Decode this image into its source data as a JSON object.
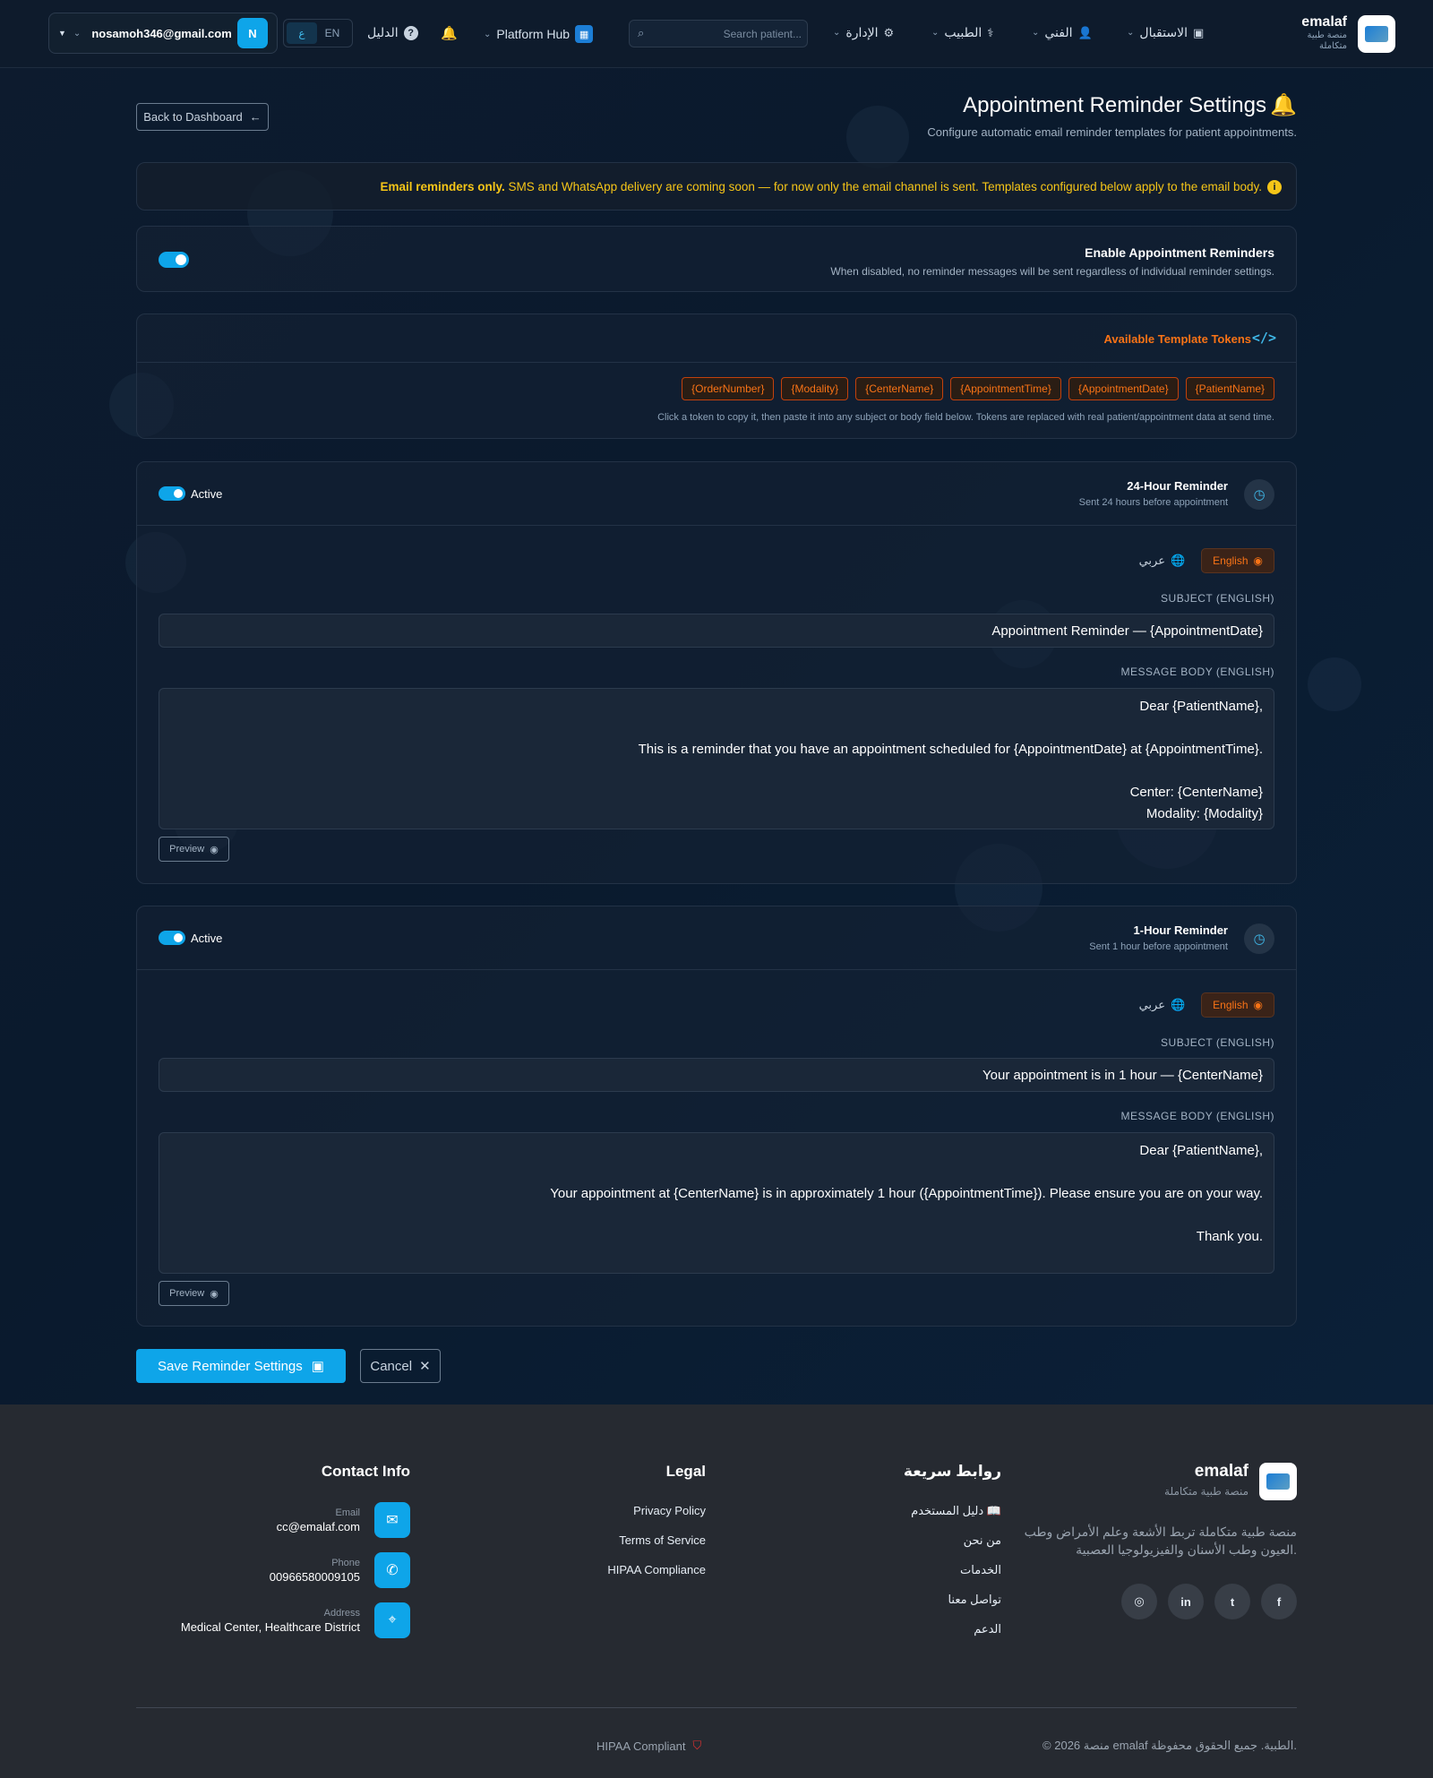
{
  "navbar": {
    "brand_name": "emalaf",
    "brand_sub": "منصة طبية متكاملة",
    "reception": "الاستقبال",
    "technician": "الفني",
    "doctor": "الطبيب",
    "admin": "الإدارة",
    "search_placeholder": "Search patient...",
    "platform_hub": "Platform Hub",
    "guide": "الدليل",
    "lang_ar": "ع",
    "lang_en": "EN",
    "user_email": "nosamoh346@gmail.com",
    "user_initial": "N"
  },
  "page": {
    "back_label": "Back to Dashboard",
    "title": "Appointment Reminder Settings",
    "subtitle": "Configure automatic email reminder templates for patient appointments."
  },
  "alert": {
    "bold": "Email reminders only.",
    "text": " SMS and WhatsApp delivery are coming soon — for now only the email channel is sent. Templates configured below apply to the email body."
  },
  "enable": {
    "title": "Enable Appointment Reminders",
    "desc": "When disabled, no reminder messages will be sent regardless of individual reminder settings."
  },
  "tokens": {
    "title": "Available Template Tokens",
    "items": [
      "{PatientName}",
      "{AppointmentDate}",
      "{AppointmentTime}",
      "{CenterName}",
      "{Modality}",
      "{OrderNumber}"
    ],
    "note": "Click a token to copy it, then paste it into any subject or body field below. Tokens are replaced with real patient/appointment data at send time."
  },
  "reminders": [
    {
      "title": "24-Hour Reminder",
      "subtitle": "Sent 24 hours before appointment",
      "active_label": "Active",
      "tab_en": "English",
      "tab_ar": "عربي",
      "subject_label": "SUBJECT (ENGLISH)",
      "subject": "Appointment Reminder — {AppointmentDate}",
      "body_label": "MESSAGE BODY (ENGLISH)",
      "body": "Dear {PatientName},\n\nThis is a reminder that you have an appointment scheduled for {AppointmentDate} at {AppointmentTime}.\n\nCenter: {CenterName}\nModality: {Modality}",
      "preview_label": "Preview"
    },
    {
      "title": "1-Hour Reminder",
      "subtitle": "Sent 1 hour before appointment",
      "active_label": "Active",
      "tab_en": "English",
      "tab_ar": "عربي",
      "subject_label": "SUBJECT (ENGLISH)",
      "subject": "Your appointment is in 1 hour — {CenterName}",
      "body_label": "MESSAGE BODY (ENGLISH)",
      "body": "Dear {PatientName},\n\nYour appointment at {CenterName} is in approximately 1 hour ({AppointmentTime}). Please ensure you are on your way.\n\nThank you.",
      "preview_label": "Preview"
    }
  ],
  "actions": {
    "save": "Save Reminder Settings",
    "cancel": "Cancel"
  },
  "footer": {
    "brand": "emalaf",
    "brand_sub": "منصة طبية متكاملة",
    "desc": "منصة طبية متكاملة تربط الأشعة وعلم الأمراض وطب العيون وطب الأسنان والفيزيولوجيا العصبية.",
    "quick_title": "روابط سريعة",
    "quick_links": [
      "دليل المستخدم",
      "من نحن",
      "الخدمات",
      "تواصل معنا",
      "الدعم"
    ],
    "legal_title": "Legal",
    "legal_links": [
      "Privacy Policy",
      "Terms of Service",
      "HIPAA Compliance"
    ],
    "contact_title": "Contact Info",
    "email_label": "Email",
    "email": "cc@emalaf.com",
    "phone_label": "Phone",
    "phone": "00966580009105",
    "address_label": "Address",
    "address": "Medical Center, Healthcare District",
    "copyright": "© 2026 منصة emalaf الطبية. جميع الحقوق محفوظة.",
    "hipaa": "HIPAA Compliant"
  },
  "colors": {
    "accent": "#0ea5e9",
    "orange": "#f97316",
    "warning": "#f5c518",
    "background": "#0a1628",
    "footer": "#262a31"
  }
}
